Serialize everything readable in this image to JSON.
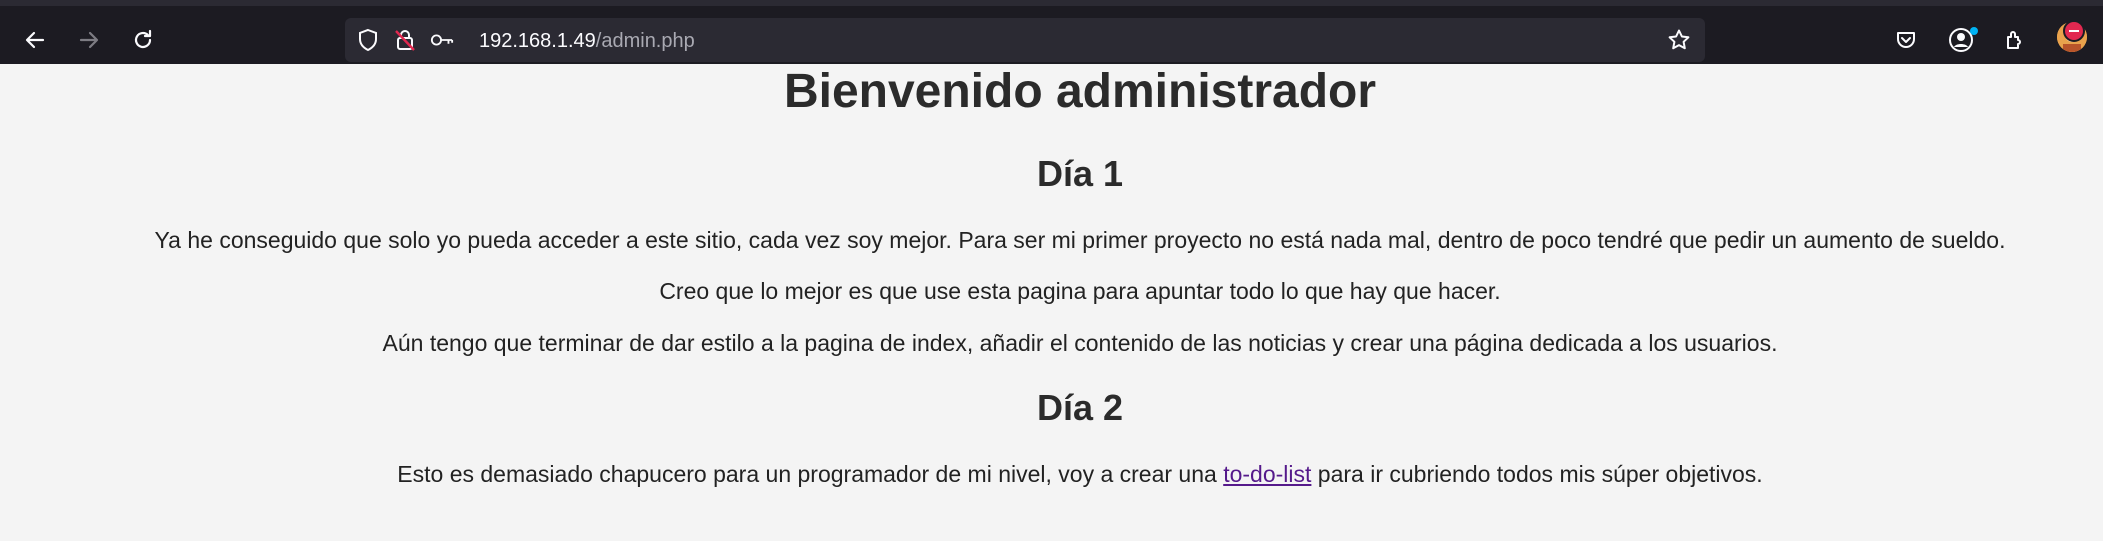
{
  "browser": {
    "url_host": "192.168.1.49",
    "url_path": "/admin.php"
  },
  "page": {
    "title": "Bienvenido administrador",
    "day1": {
      "heading": "Día 1",
      "p1": "Ya he conseguido que solo yo pueda acceder a este sitio, cada vez soy mejor. Para ser mi primer proyecto no está nada mal, dentro de poco tendré que pedir un aumento de sueldo.",
      "p2": "Creo que lo mejor es que use esta pagina para apuntar todo lo que hay que hacer.",
      "p3": "Aún tengo que terminar de dar estilo a la pagina de index, añadir el contenido de las noticias y crear una página dedicada a los usuarios."
    },
    "day2": {
      "heading": "Día 2",
      "p1_before": "Esto es demasiado chapucero para un programador de mi nivel, voy a crear una ",
      "link": "to-do-list",
      "p1_after": " para ir cubriendo todos mis súper objetivos."
    }
  },
  "icons": {
    "back": "back-arrow-icon",
    "forward": "forward-arrow-icon",
    "reload": "reload-icon",
    "shield": "shield-icon",
    "insecure": "insecure-lock-icon",
    "key": "key-icon",
    "star": "bookmark-star-icon",
    "pocket": "pocket-icon",
    "account": "account-icon",
    "extensions": "extensions-icon",
    "profile": "profile-avatar"
  },
  "colors": {
    "toolbar": "#1c1b22",
    "urlbar": "#2b2a33",
    "page_bg": "#f4f4f4",
    "link": "#551a8b"
  }
}
